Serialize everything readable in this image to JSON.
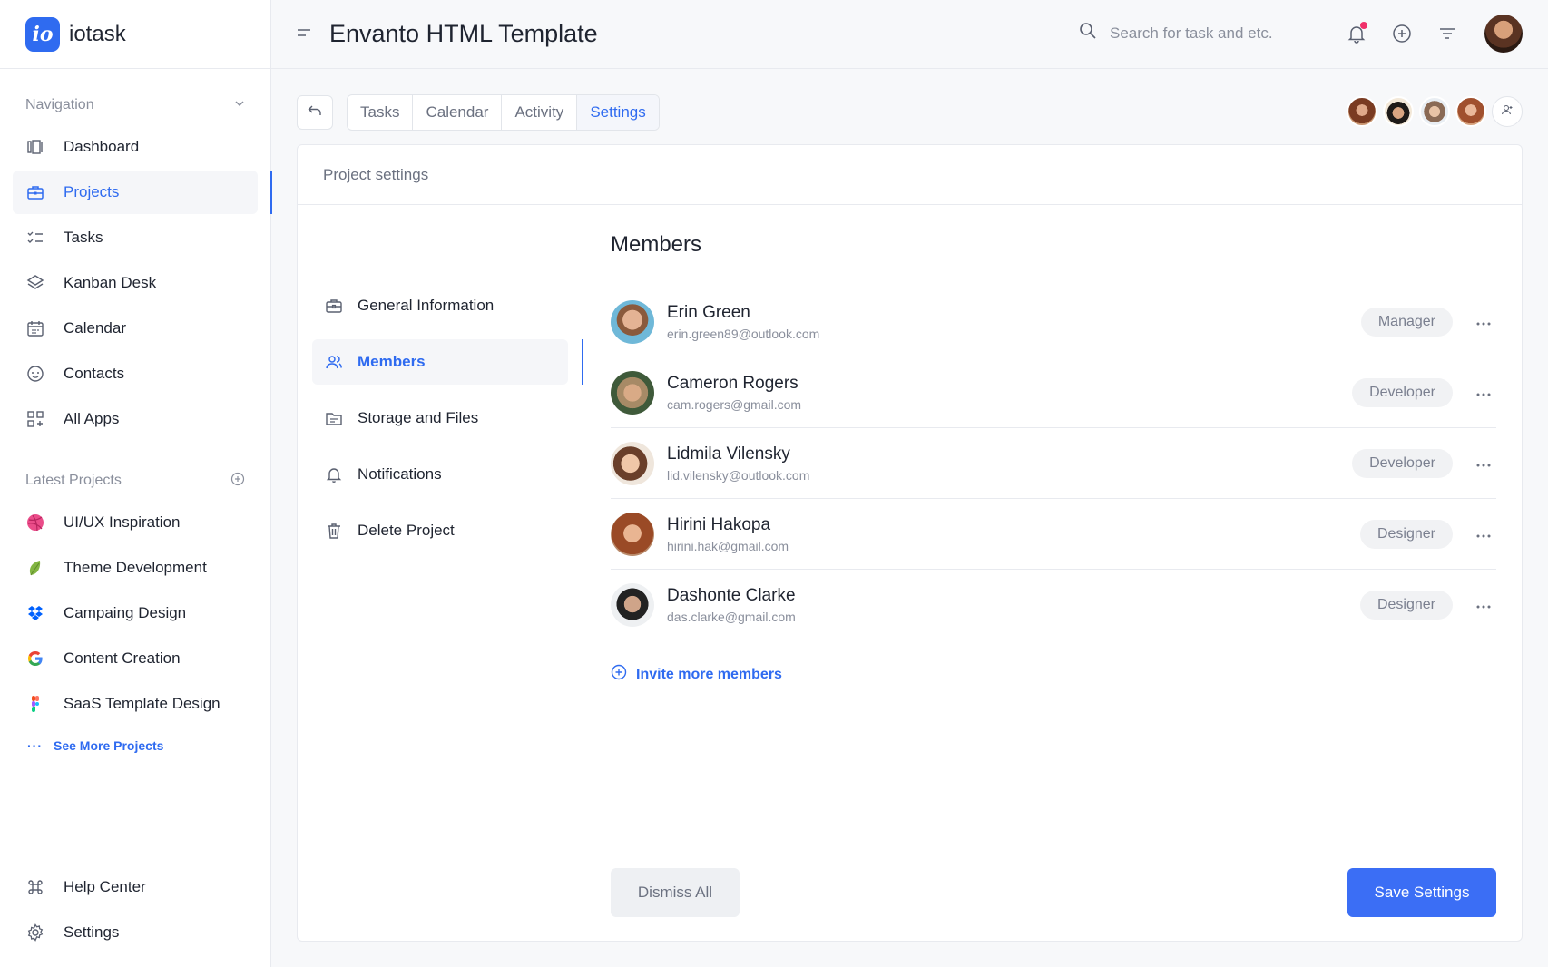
{
  "brand": {
    "logo_text": "io",
    "name": "iotask"
  },
  "header": {
    "title": "Envanto HTML Template",
    "search_placeholder": "Search for task and etc."
  },
  "sidebar": {
    "navigation_label": "Navigation",
    "items": [
      {
        "label": "Dashboard",
        "icon": "dashboard-icon"
      },
      {
        "label": "Projects",
        "icon": "briefcase-icon",
        "active": true
      },
      {
        "label": "Tasks",
        "icon": "checklist-icon"
      },
      {
        "label": "Kanban Desk",
        "icon": "layers-icon"
      },
      {
        "label": "Calendar",
        "icon": "calendar-icon"
      },
      {
        "label": "Contacts",
        "icon": "smile-icon"
      },
      {
        "label": "All Apps",
        "icon": "grid-icon"
      }
    ],
    "latest_label": "Latest Projects",
    "projects": [
      {
        "label": "UI/UX Inspiration",
        "icon": "dribbble-icon"
      },
      {
        "label": "Theme Development",
        "icon": "leaf-icon"
      },
      {
        "label": "Campaing Design",
        "icon": "dropbox-icon"
      },
      {
        "label": "Content Creation",
        "icon": "google-icon"
      },
      {
        "label": "SaaS Template Design",
        "icon": "figma-icon"
      }
    ],
    "see_more": "See More Projects",
    "bottom": [
      {
        "label": "Help Center",
        "icon": "command-icon"
      },
      {
        "label": "Settings",
        "icon": "gear-icon"
      }
    ]
  },
  "tabs": [
    {
      "label": "Tasks"
    },
    {
      "label": "Calendar"
    },
    {
      "label": "Activity"
    },
    {
      "label": "Settings",
      "active": true
    }
  ],
  "panel": {
    "title": "Project settings",
    "nav": [
      {
        "label": "General Information",
        "icon": "briefcase-icon"
      },
      {
        "label": "Members",
        "icon": "users-icon",
        "active": true
      },
      {
        "label": "Storage and Files",
        "icon": "folder-icon"
      },
      {
        "label": "Notifications",
        "icon": "bell-icon"
      },
      {
        "label": "Delete Project",
        "icon": "trash-icon"
      }
    ],
    "members_title": "Members",
    "members": [
      {
        "name": "Erin Green",
        "email": "erin.green89@outlook.com",
        "role": "Manager"
      },
      {
        "name": "Cameron Rogers",
        "email": "cam.rogers@gmail.com",
        "role": "Developer"
      },
      {
        "name": "Lidmila Vilensky",
        "email": "lid.vilensky@outlook.com",
        "role": "Developer"
      },
      {
        "name": "Hirini Hakopa",
        "email": "hirini.hak@gmail.com",
        "role": "Designer"
      },
      {
        "name": "Dashonte Clarke",
        "email": "das.clarke@gmail.com",
        "role": "Designer"
      }
    ],
    "invite_label": "Invite more members",
    "dismiss_label": "Dismiss All",
    "save_label": "Save Settings"
  },
  "colors": {
    "accent": "#2f6bf0",
    "notification": "#f0306a"
  }
}
